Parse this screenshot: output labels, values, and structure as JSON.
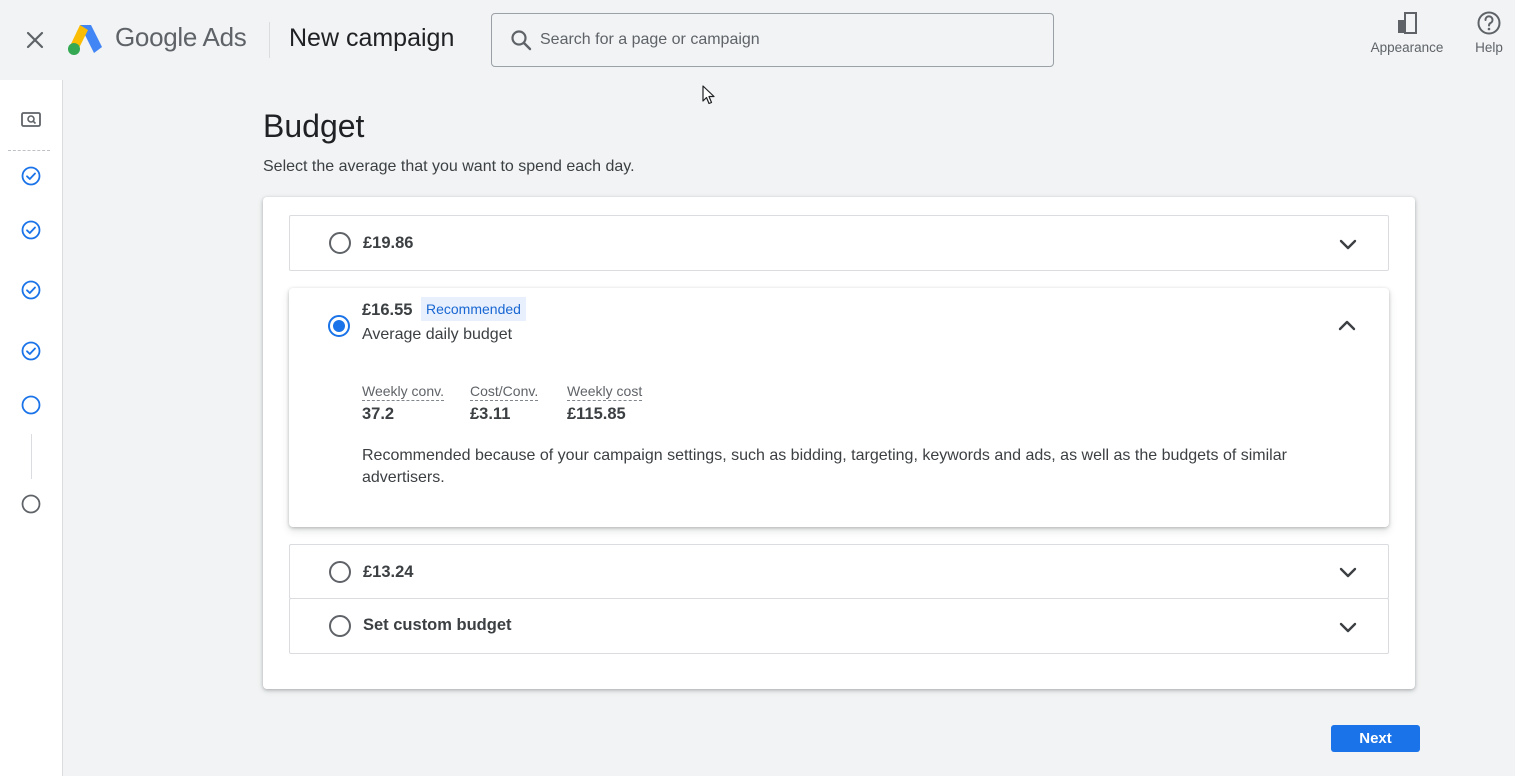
{
  "header": {
    "brand_google": "Google",
    "brand_ads": "Ads",
    "page_title": "New campaign",
    "search_placeholder": "Search for a page or campaign",
    "appearance_label": "Appearance",
    "help_label": "Help"
  },
  "rail": {
    "icons": [
      "search-preview-icon",
      "check-circle-icon",
      "check-circle-icon",
      "check-circle-icon",
      "check-circle-icon",
      "empty-circle-icon",
      "empty-circle-icon"
    ]
  },
  "main": {
    "title": "Budget",
    "subtitle": "Select the average that you want to spend each day.",
    "options": [
      {
        "amount": "£19.86",
        "selected": false,
        "expanded": false
      },
      {
        "amount": "£16.55",
        "badge": "Recommended",
        "description": "Average daily budget",
        "selected": true,
        "expanded": true,
        "metrics": [
          {
            "label": "Weekly conv.",
            "value": "37.2"
          },
          {
            "label": "Cost/Conv.",
            "value": "£3.11"
          },
          {
            "label": "Weekly cost",
            "value": "£115.85"
          }
        ],
        "recommendation_text": "Recommended because of your campaign settings, such as bidding, targeting, keywords and ads, as well as the budgets of similar advertisers."
      },
      {
        "amount": "£13.24",
        "selected": false,
        "expanded": false
      },
      {
        "amount": "Set custom budget",
        "selected": false,
        "expanded": false
      }
    ],
    "next_label": "Next"
  },
  "colors": {
    "accent": "#1a73e8",
    "background": "#f1f3f4",
    "badge_bg": "#e8f0fe"
  }
}
